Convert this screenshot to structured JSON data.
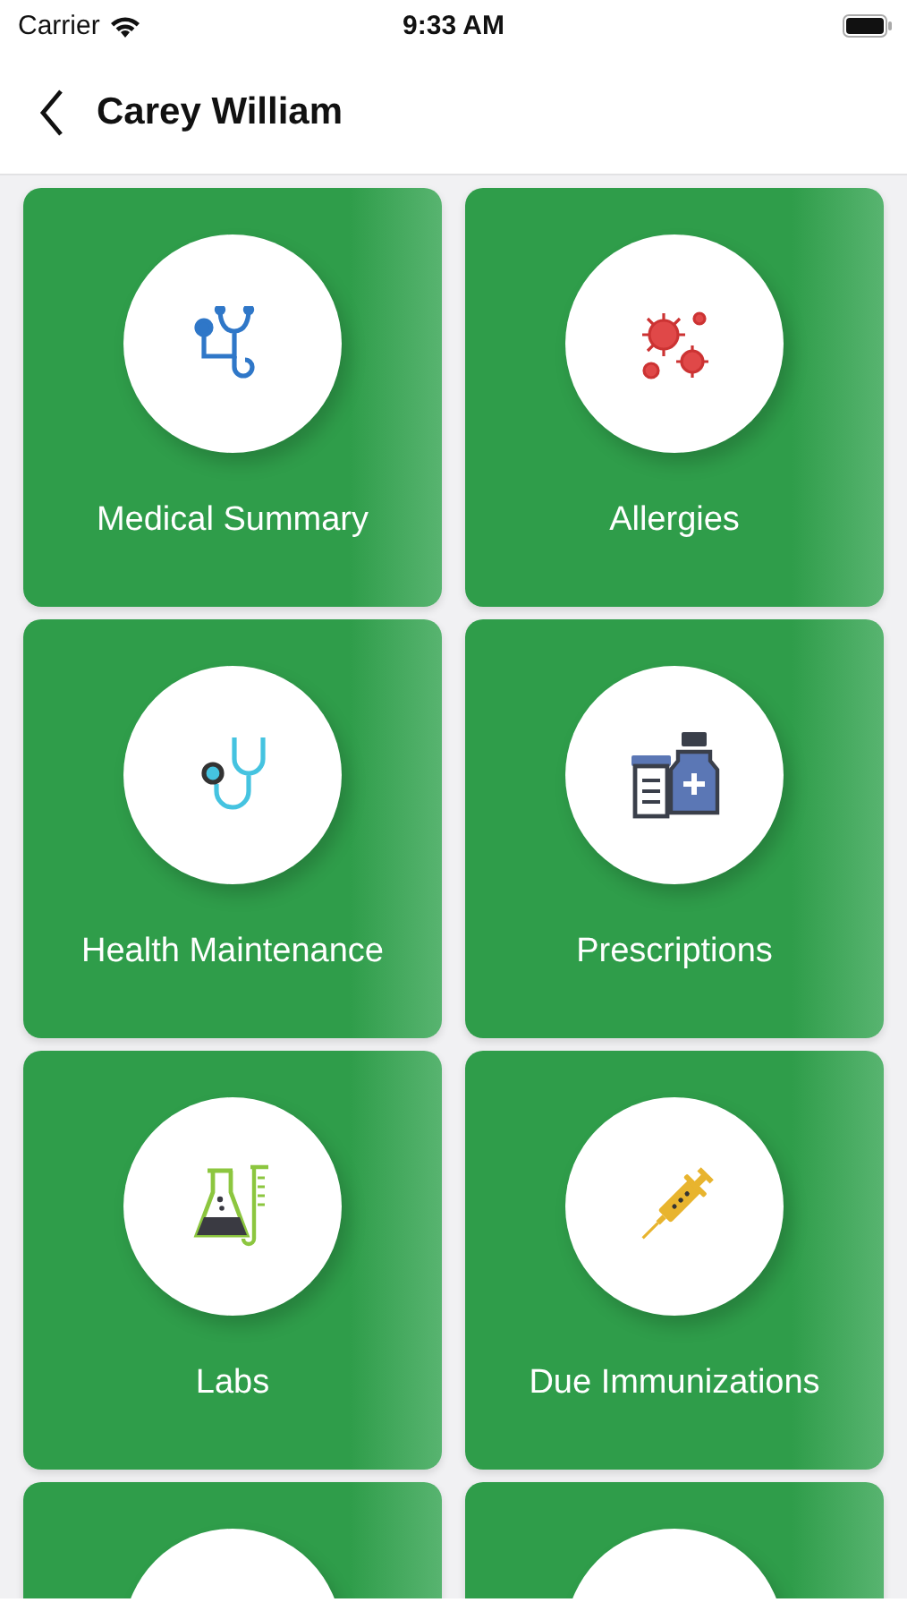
{
  "status_bar": {
    "carrier": "Carrier",
    "time": "9:33 AM"
  },
  "nav": {
    "title": "Carey William"
  },
  "tiles": [
    {
      "kind": "tile",
      "label": "Medical Summary"
    },
    {
      "kind": "tile",
      "label": "Allergies"
    },
    {
      "kind": "tile",
      "label": "Health Maintenance"
    },
    {
      "kind": "tile",
      "label": "Prescriptions"
    },
    {
      "kind": "tile",
      "label": "Labs"
    },
    {
      "kind": "tile",
      "label": "Due Immunizations"
    },
    {
      "kind": "partial"
    },
    {
      "kind": "partial"
    }
  ]
}
